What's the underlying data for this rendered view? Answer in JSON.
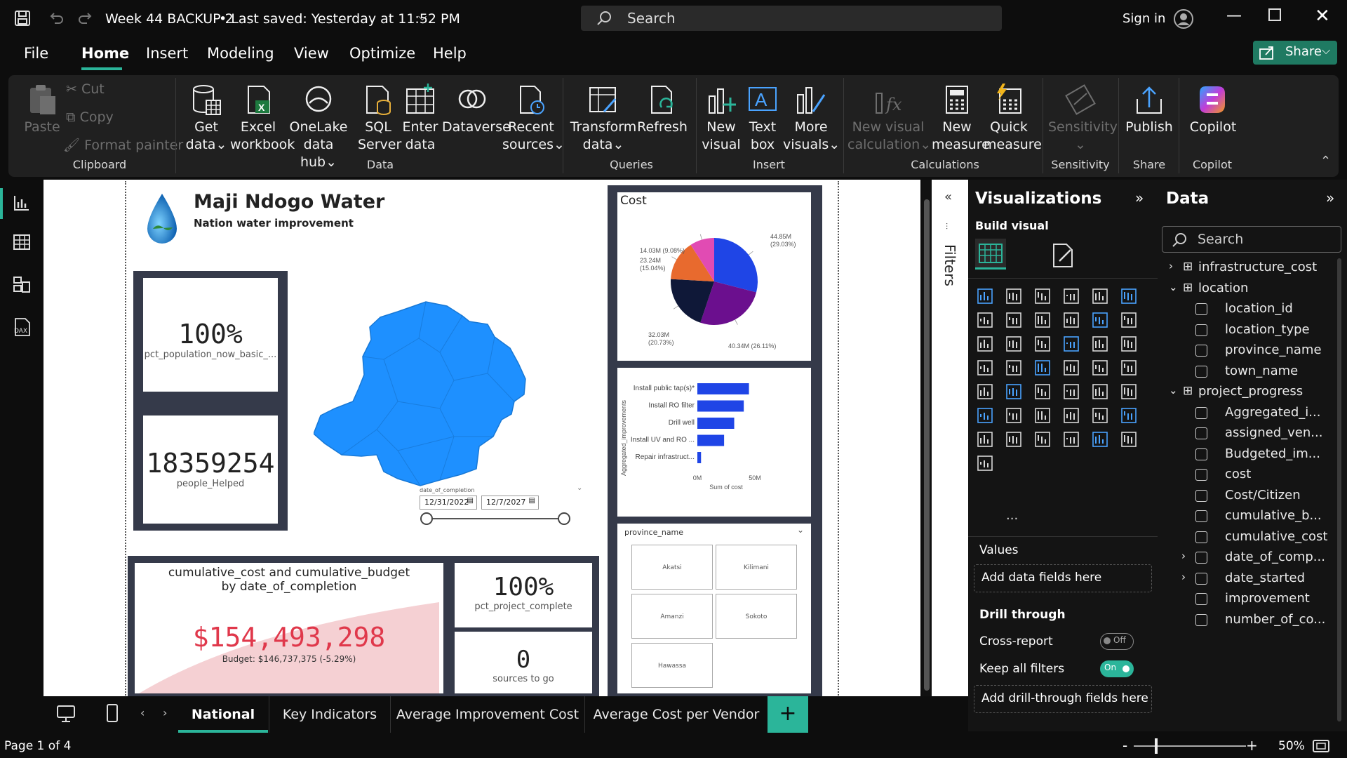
{
  "titlebar": {
    "title": "Week 44 BACKUP 2",
    "saved": "• Last saved: Yesterday at 11:52 PM",
    "search_placeholder": "Search",
    "sign_in": "Sign in"
  },
  "menu": {
    "items": [
      "File",
      "Home",
      "Insert",
      "Modeling",
      "View",
      "Optimize",
      "Help"
    ],
    "active": "Home",
    "share": "Share"
  },
  "ribbon": {
    "clipboard": {
      "paste": "Paste",
      "cut": "Cut",
      "copy": "Copy",
      "format_painter": "Format painter",
      "group": "Clipboard"
    },
    "data": {
      "get_data": "Get",
      "get_data2": "data",
      "excel": "Excel",
      "excel2": "workbook",
      "onelake": "OneLake",
      "onelake2": "data hub",
      "sql": "SQL",
      "sql2": "Server",
      "enter": "Enter",
      "enter2": "data",
      "dataverse": "Dataverse",
      "recent": "Recent",
      "recent2": "sources",
      "group": "Data"
    },
    "queries": {
      "transform": "Transform",
      "transform2": "data",
      "refresh": "Refresh",
      "group": "Queries"
    },
    "insert": {
      "new_visual": "New",
      "new_visual2": "visual",
      "text_box": "Text",
      "text_box2": "box",
      "more": "More",
      "more2": "visuals",
      "group": "Insert"
    },
    "calculations": {
      "new_vc": "New visual",
      "new_vc2": "calculation",
      "new_measure": "New",
      "new_measure2": "measure",
      "quick": "Quick",
      "quick2": "measure",
      "group": "Calculations"
    },
    "sensitivity": {
      "label": "Sensitivity",
      "group": "Sensitivity"
    },
    "share": {
      "publish": "Publish",
      "group": "Share"
    },
    "copilot": {
      "label": "Copilot",
      "group": "Copilot"
    }
  },
  "report": {
    "title": "Maji Ndogo Water",
    "subtitle": "Nation water improvement",
    "kpi1": {
      "value": "100%",
      "label": "pct_population_now_basic_..."
    },
    "kpi2": {
      "value": "18359254",
      "label": "people_Helped"
    },
    "slicer": {
      "label": "date_of_completion",
      "start": "12/31/2022",
      "end": "12/7/2027"
    },
    "cost_chart": {
      "title": "Cost"
    },
    "bar_chart": {
      "ylabel": "Aggregated_improvements",
      "xlabel": "Sum of cost"
    },
    "province_slicer": {
      "title": "province_name",
      "items": [
        "Akatsi",
        "Kilimani",
        "Amanzi",
        "Sokoto",
        "Hawassa"
      ]
    },
    "cumulative": {
      "title": "cumulative_cost and cumulative_budget",
      "title2": "by date_of_completion",
      "value": "$154,493,298",
      "budget": "Budget: $146,737,375 (-5.29%)"
    },
    "kpi3": {
      "value": "100%",
      "label": "pct_project_complete"
    },
    "kpi4": {
      "value": "0",
      "label": "sources to go"
    }
  },
  "chart_data": [
    {
      "type": "pie",
      "title": "Cost",
      "slices": [
        {
          "label": "44.85M (29.03%)",
          "value": 44.85,
          "color": "#1f45e6"
        },
        {
          "label": "40.34M (26.11%)",
          "value": 40.34,
          "color": "#6b0f8e"
        },
        {
          "label": "32.03M (20.73%)",
          "value": 32.03,
          "color": "#0f1838"
        },
        {
          "label": "23.24M (15.04%)",
          "value": 23.24,
          "color": "#e86a2e"
        },
        {
          "label": "14.03M (9.08%)",
          "value": 14.03,
          "color": "#e14bb3"
        }
      ]
    },
    {
      "type": "bar",
      "orientation": "horizontal",
      "categories": [
        "Install public tap(s)*",
        "Install RO filter",
        "Drill well",
        "Install UV and RO ...",
        "Repair infrastruct..."
      ],
      "values": [
        44.85,
        40.34,
        32.03,
        23.24,
        3.2
      ],
      "xlim": [
        0,
        50
      ],
      "xticks": [
        "0M",
        "50M"
      ],
      "xlabel": "Sum of cost",
      "ylabel": "Aggregated_improvements",
      "color": "#1f45e6"
    }
  ],
  "tabs": {
    "items": [
      "National",
      "Key Indicators",
      "Average Improvement Cost",
      "Average Cost per Vendor"
    ],
    "active": "National",
    "add": "+"
  },
  "status": {
    "page": "Page 1 of 4",
    "zoom": "50%",
    "zoom_minus": "-",
    "zoom_plus": "+"
  },
  "filters": {
    "label": "Filters"
  },
  "visualizations": {
    "title": "Visualizations",
    "build": "Build visual",
    "values": "Values",
    "add_fields": "Add data fields here",
    "drill": "Drill through",
    "cross": "Cross-report",
    "cross_state": "Off",
    "keep": "Keep all filters",
    "keep_state": "On",
    "add_drill": "Add drill-through fields here",
    "more": "..."
  },
  "data": {
    "title": "Data",
    "search": "Search",
    "tables": [
      {
        "name": "infrastructure_cost",
        "expanded": false
      },
      {
        "name": "location",
        "expanded": true,
        "fields": [
          "location_id",
          "location_type",
          "province_name",
          "town_name"
        ]
      },
      {
        "name": "project_progress",
        "expanded": true,
        "fields": [
          "Aggregated_i...",
          "assigned_ven...",
          "Budgeted_im...",
          "cost",
          "Cost/Citizen",
          "cumulative_b...",
          "cumulative_cost",
          "date_of_comp...",
          "date_started",
          "improvement",
          "number_of_co..."
        ]
      }
    ]
  },
  "colors": {
    "accent": "#2bb59a",
    "brand_blue": "#1f45e6",
    "red_value": "#e0384b",
    "map_blue": "#1e90ff"
  }
}
